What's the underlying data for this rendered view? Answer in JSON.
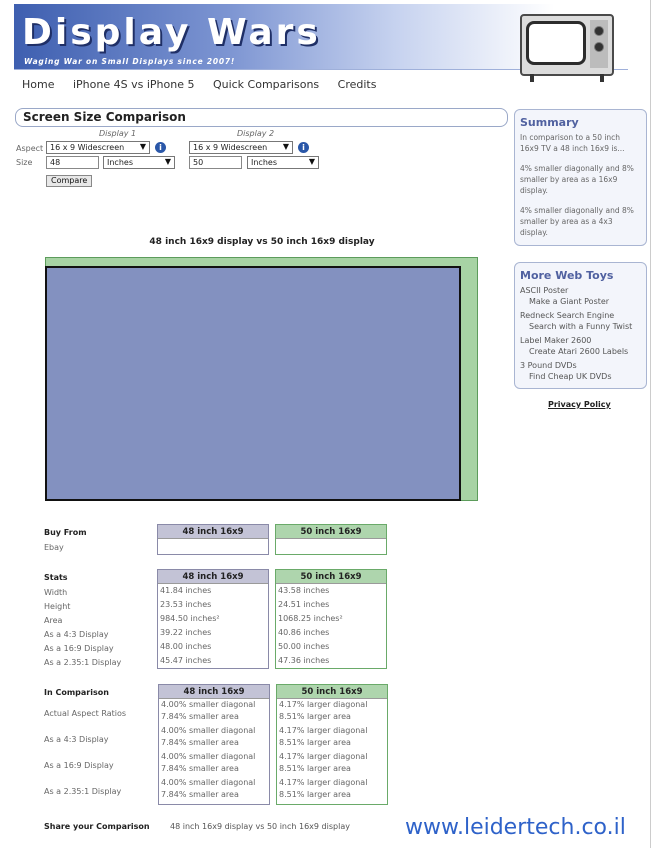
{
  "header": {
    "title": "Display Wars",
    "tagline": "Waging War on Small Displays since 2007!"
  },
  "nav": [
    "Home",
    "iPhone 4S vs iPhone 5",
    "Quick Comparisons",
    "Credits"
  ],
  "comparison_form": {
    "panel_title": "Screen Size Comparison",
    "display1_title": "Display 1",
    "display2_title": "Display 2",
    "aspect_label": "Aspect",
    "size_label": "Size",
    "display1_aspect": "16 x 9 Widescreen",
    "display2_aspect": "16 x 9 Widescreen",
    "display1_size": "48",
    "display2_size": "50",
    "display1_unit": "Inches",
    "display2_unit": "Inches",
    "compare_button": "Compare"
  },
  "visual": {
    "title": "48 inch 16x9 display vs 50 inch 16x9 display",
    "colors": {
      "display1": "#8391c0",
      "display2": "#a7d3a4"
    }
  },
  "summary": {
    "title": "Summary",
    "paragraphs": [
      "In comparison to a 50 inch 16x9 TV a 48 inch 16x9 is...",
      "4% smaller diagonally and 8% smaller by area as a 16x9 display.",
      "4% smaller diagonally and 8% smaller by area as a 4x3 display."
    ]
  },
  "web_toys": {
    "title": "More Web Toys",
    "items": [
      {
        "name": "ASCII Poster",
        "desc": "Make a Giant Poster"
      },
      {
        "name": "Redneck Search Engine",
        "desc": "Search with a Funny Twist"
      },
      {
        "name": "Label Maker 2600",
        "desc": "Create Atari 2600 Labels"
      },
      {
        "name": "3 Pound DVDs",
        "desc": "Find Cheap UK DVDs"
      }
    ]
  },
  "privacy_link": "Privacy Policy",
  "columns": {
    "display1": "48 inch 16x9",
    "display2": "50 inch 16x9"
  },
  "buy_from": {
    "label": "Buy From",
    "rows": [
      "Ebay"
    ]
  },
  "stats": {
    "label": "Stats",
    "rows": [
      "Width",
      "Height",
      "Area",
      "As a 4:3 Display",
      "As a 16:9 Display",
      "As a 2.35:1 Display"
    ],
    "display1": [
      "41.84 inches",
      "23.53 inches",
      "984.50 inches²",
      "39.22 inches",
      "48.00 inches",
      "45.47 inches"
    ],
    "display2": [
      "43.58 inches",
      "24.51 inches",
      "1068.25 inches²",
      "40.86 inches",
      "50.00 inches",
      "47.36 inches"
    ]
  },
  "in_comparison": {
    "label": "In Comparison",
    "rows": [
      "Actual Aspect Ratios",
      "As a 4:3 Display",
      "As a 16:9 Display",
      "As a 2.35:1 Display"
    ],
    "display1": [
      [
        "4.00% smaller diagonal",
        "7.84% smaller area"
      ],
      [
        "4.00% smaller diagonal",
        "7.84% smaller area"
      ],
      [
        "4.00% smaller diagonal",
        "7.84% smaller area"
      ],
      [
        "4.00% smaller diagonal",
        "7.84% smaller area"
      ]
    ],
    "display2": [
      [
        "4.17% larger diagonal",
        "8.51% larger area"
      ],
      [
        "4.17% larger diagonal",
        "8.51% larger area"
      ],
      [
        "4.17% larger diagonal",
        "8.51% larger area"
      ],
      [
        "4.17% larger diagonal",
        "8.51% larger area"
      ]
    ]
  },
  "share": {
    "label": "Share your Comparison",
    "text": "48 inch 16x9 display vs 50 inch 16x9 display"
  },
  "watermark": "www.leidertech.co.il"
}
